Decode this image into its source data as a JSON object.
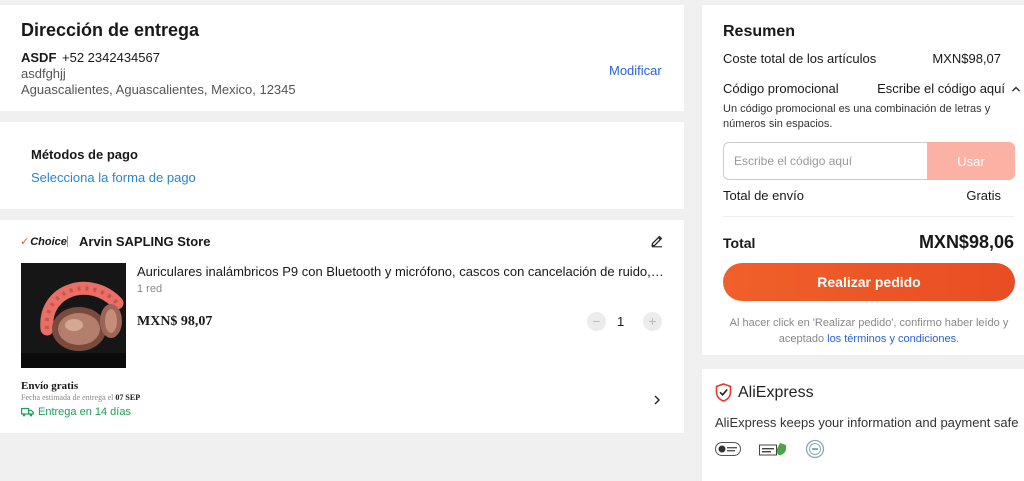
{
  "address": {
    "title": "Dirección de entrega",
    "name": "ASDF",
    "phone": "+52 2342434567",
    "line2": "asdfghjj",
    "line3": "Aguascalientes, Aguascalientes, Mexico, 12345",
    "modify_label": "Modificar"
  },
  "payment": {
    "title": "Métodos de pago",
    "select_label": "Selecciona la forma de pago"
  },
  "order": {
    "badge": "Choice",
    "store_name": "Arvin SAPLING Store",
    "product": {
      "title": "Auriculares inalámbricos P9 con Bluetooth y micrófono, cascos con cancelación de ruido, s...",
      "variant": "1 red",
      "price": "MXN$ 98,07",
      "quantity": "1"
    },
    "shipping": {
      "free_label": "Envío gratis",
      "estimate_prefix": "Fecha estimada de entrega el",
      "estimate_date": "07 SEP",
      "delivery": "Entrega en 14 días"
    }
  },
  "summary": {
    "title": "Resumen",
    "items_cost_label": "Coste total de los artículos",
    "items_cost_value": "MXN$98,07",
    "promo_label": "Código promocional",
    "promo_action": "Escribe el código aquí",
    "promo_note": "Un código promocional es una combinación de letras y números sin espacios.",
    "promo_placeholder": "Escribe el código aquí",
    "promo_button": "Usar",
    "shipping_label": "Total de envío",
    "shipping_value": "Gratis",
    "total_label": "Total",
    "total_value": "MXN$98,06",
    "place_order": "Realizar pedido",
    "legal_text": "Al hacer click en 'Realizar pedido', confirmo haber leído y aceptado",
    "legal_link": "los términos y condiciones",
    "legal_end": "."
  },
  "trust": {
    "brand": "AliExpress",
    "text": "AliExpress keeps your information and payment safe"
  },
  "colors": {
    "accent": "#e94d23",
    "link": "#2a62d8",
    "delivery_green": "#1e9e5b",
    "promo_button": "#fbb2a4"
  }
}
